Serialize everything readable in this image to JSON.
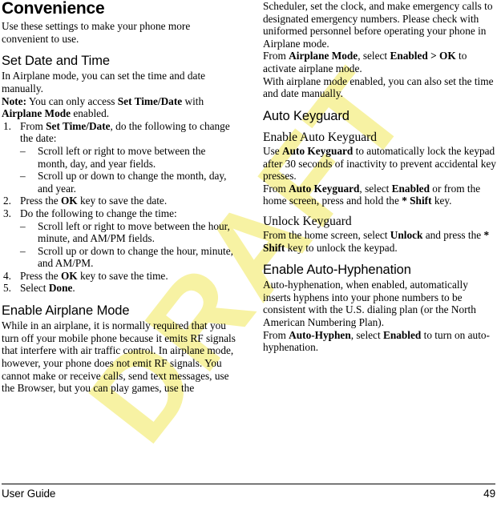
{
  "page": {
    "watermark": "DRAFT",
    "watermark_color": "#f7f2a3",
    "background_color": "#ffffff",
    "text_color": "#000000"
  },
  "footer": {
    "left_label": "User Guide",
    "page_number": "49"
  },
  "left_column": {
    "title": "Convenience",
    "intro": "Use these settings to make your phone more convenient to use.",
    "section_set_date": {
      "heading": "Set Date and Time",
      "para1": "In Airplane mode, you can set the time and date manually.",
      "note_label": "Note:",
      "note_text_1": " You can only access ",
      "note_bold_1": "Set Time/Date",
      "note_text_2": " with ",
      "note_bold_2": "Airplane Mode",
      "note_text_3": " enabled.",
      "steps": [
        {
          "num": "1.",
          "text_pre": "From ",
          "bold": "Set Time/Date",
          "text_post": ", do the following to change the date:",
          "sub": [
            "Scroll left or right to move between the month, day, and year fields.",
            "Scroll up or down to change the month, day, and year."
          ]
        },
        {
          "num": "2.",
          "text_pre": "Press the ",
          "bold": "OK",
          "text_post": " key to save the date.",
          "sub": []
        },
        {
          "num": "3.",
          "text_pre": "Do the following to change the time:",
          "bold": "",
          "text_post": "",
          "sub": [
            "Scroll left or right to move between the hour, minute, and AM/PM fields.",
            "Scroll up or down to change the hour, minute, and AM/PM."
          ]
        },
        {
          "num": "4.",
          "text_pre": "Press the ",
          "bold": "OK",
          "text_post": " key to save the time.",
          "sub": []
        },
        {
          "num": "5.",
          "text_pre": "Select ",
          "bold": "Done",
          "text_post": ".",
          "sub": []
        }
      ]
    },
    "section_airplane": {
      "heading": "Enable Airplane Mode",
      "para1": "While in an airplane, it is normally required that you turn off your mobile phone because it emits RF signals that interfere with air traffic control. In airplane mode, however, your phone does not emit RF signals. You cannot make or receive calls, send text messages, use the Browser, but you can play games, use the"
    }
  },
  "right_column": {
    "airplane_continued": {
      "para1": "Scheduler, set the clock, and make emergency calls to designated emergency numbers. Please check with uniformed personnel before operating your phone in Airplane mode.",
      "para2_pre": "From ",
      "para2_bold1": "Airplane Mode",
      "para2_mid": ", select ",
      "para2_bold2": "Enabled > OK",
      "para2_post": " to activate airplane mode.",
      "para3": "With airplane mode enabled, you can also set the time and date manually."
    },
    "section_auto_keyguard": {
      "heading": "Auto Keyguard",
      "sub_enable": {
        "heading": "Enable Auto Keyguard",
        "para1_pre": "Use ",
        "para1_bold": "Auto Keyguard",
        "para1_post": " to automatically lock the keypad after 30 seconds of inactivity to prevent accidental key presses.",
        "para2_pre": "From ",
        "para2_bold1": "Auto Keyguard",
        "para2_mid": ", select ",
        "para2_bold2": "Enabled",
        "para2_mid2": " or from the home screen, press and hold the ",
        "para2_bold3": "* Shift",
        "para2_post": " key."
      },
      "sub_unlock": {
        "heading": "Unlock Keyguard",
        "para1_pre": "From the home screen, select ",
        "para1_bold1": "Unlock",
        "para1_mid": " and press the ",
        "para1_bold2": "* Shift",
        "para1_post": " key to unlock the keypad."
      }
    },
    "section_hyphenation": {
      "heading": "Enable Auto-Hyphenation",
      "para1": "Auto-hyphenation, when enabled, automatically inserts hyphens into your phone numbers to be consistent with the U.S. dialing plan (or the North American Numbering Plan).",
      "para2_pre": "From ",
      "para2_bold1": "Auto-Hyphen",
      "para2_mid": ", select ",
      "para2_bold2": "Enabled",
      "para2_post": " to turn on auto-hyphenation."
    }
  }
}
